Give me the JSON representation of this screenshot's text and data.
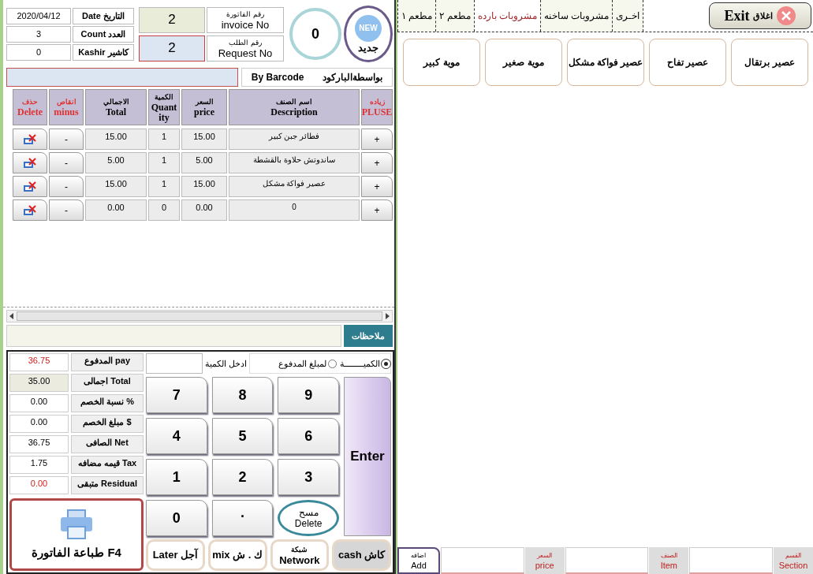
{
  "info": [
    {
      "label": "Date التاريخ",
      "value": "2020/04/12"
    },
    {
      "label": "Count  العدد",
      "value": "3"
    },
    {
      "label": "Kashir كاشير",
      "value": "0"
    }
  ],
  "numbers": [
    {
      "label_ar": "رقم الفاتورة",
      "label_en": "invoice No",
      "value": "2",
      "kind": "invoice"
    },
    {
      "label_ar": "رقم الطلب",
      "label_en": "Request No",
      "value": "2",
      "kind": "request"
    }
  ],
  "counter": "0",
  "new_button": {
    "badge": "NEW",
    "label": "جديد"
  },
  "barcode": {
    "label_en": "By Barcode",
    "label_ar": "بواسطةالباركود"
  },
  "table": {
    "columns": [
      {
        "ar": "زياده",
        "en": "PLUSE",
        "kind": "action"
      },
      {
        "ar": "اسم الصنف",
        "en": "Description",
        "kind": "data"
      },
      {
        "ar": "السعر",
        "en": "price",
        "kind": "data"
      },
      {
        "ar": "الكمية",
        "en": "Quant ity",
        "kind": "data"
      },
      {
        "ar": "الاجمالي",
        "en": "Total",
        "kind": "data"
      },
      {
        "ar": "انقاص",
        "en": "minus",
        "kind": "action"
      },
      {
        "ar": "حذف",
        "en": "Delete",
        "kind": "action"
      }
    ],
    "rows": [
      {
        "plus": "+",
        "description": "فطائر جبن كبير",
        "price": "15.00",
        "qty": "1",
        "total": "15.00",
        "minus": "-"
      },
      {
        "plus": "+",
        "description": "ساندوتش حلاوة بالقشطة",
        "price": "5.00",
        "qty": "1",
        "total": "5.00",
        "minus": "-"
      },
      {
        "plus": "+",
        "description": "عصير فواكة مشكل",
        "price": "15.00",
        "qty": "1",
        "total": "15.00",
        "minus": "-"
      },
      {
        "plus": "+",
        "description": "0",
        "price": "0.00",
        "qty": "0",
        "total": "0.00",
        "minus": "-"
      }
    ]
  },
  "notes_label": "ملاحظات",
  "summary": [
    {
      "label": "المدفوع pay",
      "value": "36.75",
      "alert": true,
      "shaded": false
    },
    {
      "label": "اجمالى Total",
      "value": "35.00",
      "alert": false,
      "shaded": true
    },
    {
      "label": "نسبة الخصم %",
      "value": "0.00",
      "alert": false,
      "shaded": false
    },
    {
      "label": "مبلغ الخصم $",
      "value": "0.00",
      "alert": false,
      "shaded": false
    },
    {
      "label": "الصافى Net",
      "value": "36.75",
      "alert": false,
      "shaded": false
    },
    {
      "label": "قيمه مضافه Tax",
      "value": "1.75",
      "alert": false,
      "shaded": false
    },
    {
      "label": "متبقى Residual",
      "value": "0.00",
      "alert": true,
      "shaded": false
    }
  ],
  "print_button": "طباعة الفاتورة F4",
  "modes": [
    {
      "label": "الكميــــــــة",
      "selected": true
    },
    {
      "label": "لمبلغ المدفوع",
      "selected": false
    }
  ],
  "quantity_label": "ادخل الكمية",
  "keys": [
    {
      "kind": "digit",
      "label": "9"
    },
    {
      "kind": "digit",
      "label": "8"
    },
    {
      "kind": "digit",
      "label": "7"
    },
    {
      "kind": "digit",
      "label": "6"
    },
    {
      "kind": "digit",
      "label": "5"
    },
    {
      "kind": "digit",
      "label": "4"
    },
    {
      "kind": "digit",
      "label": "3"
    },
    {
      "kind": "digit",
      "label": "2"
    },
    {
      "kind": "digit",
      "label": "1"
    },
    {
      "kind": "delete",
      "ar": "مسح",
      "en": "Delete"
    },
    {
      "kind": "point",
      "label": "."
    },
    {
      "kind": "digit",
      "label": "0"
    }
  ],
  "enter_key": "Enter",
  "payments": [
    {
      "label": "cash كاش",
      "selected": true
    },
    {
      "ar": "شبكة",
      "en": "Network",
      "selected": false
    },
    {
      "label": "mix ك . ش",
      "selected": false
    },
    {
      "label": "Later آجل",
      "selected": false
    }
  ],
  "exit_button": {
    "ar": "اغلاق",
    "en": "Exit"
  },
  "tabs": [
    {
      "label": "اخـرى",
      "selected": false
    },
    {
      "label": "مشروبات ساخنه",
      "selected": false
    },
    {
      "label": "مشروبات بارده",
      "selected": true
    },
    {
      "label": "مطعم ٢",
      "selected": false
    },
    {
      "label": "مطعم ١",
      "selected": false
    }
  ],
  "items": [
    "عصير برتقال",
    "عصير تفاح",
    "عصير فواكة مشكل",
    "موية صغير",
    "موية كبير"
  ],
  "entry_bar": {
    "fields": [
      {
        "ar": "القسم",
        "en": "Section"
      },
      {
        "ar": "الصنف",
        "en": "Item"
      },
      {
        "ar": "السعر",
        "en": "price"
      }
    ],
    "add": {
      "ar": "اضافه",
      "en": "Add"
    }
  }
}
